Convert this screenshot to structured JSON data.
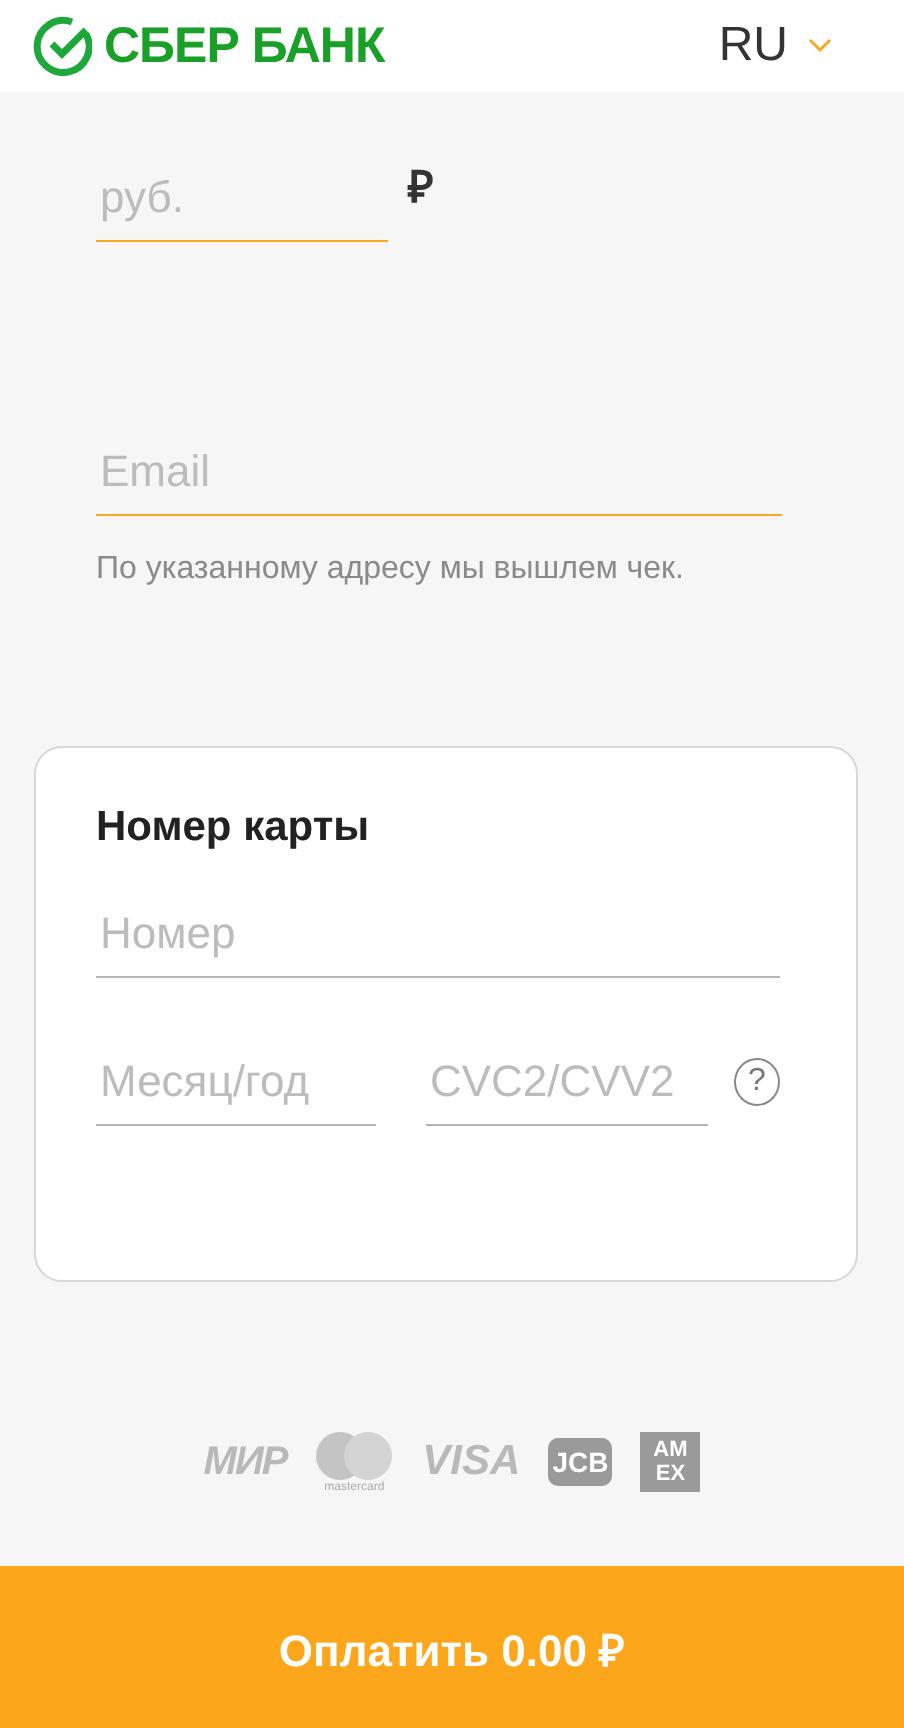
{
  "header": {
    "logo_text": "СБЕР БАНК",
    "language": "RU"
  },
  "amount": {
    "placeholder": "руб.",
    "currency": "₽",
    "highlighted": true
  },
  "email": {
    "placeholder": "Email",
    "highlighted": true,
    "hint": "По указанному адресу мы вышлем чек."
  },
  "card": {
    "title": "Номер карты",
    "number": {
      "placeholder": "Номер",
      "highlighted": false
    },
    "expiry": {
      "placeholder": "Месяц/год",
      "highlighted": false
    },
    "cvc": {
      "placeholder": "CVC2/CVV2",
      "highlighted": false,
      "help": "?"
    }
  },
  "payment_logos": [
    {
      "kind": "mir",
      "label": "МИР"
    },
    {
      "kind": "mastercard",
      "label": "mastercard"
    },
    {
      "kind": "visa",
      "label": "VISA"
    },
    {
      "kind": "jcb",
      "label": "JCB"
    },
    {
      "kind": "amex",
      "label": "AM EX"
    }
  ],
  "pay_button": "Оплатить 0.00 ₽"
}
